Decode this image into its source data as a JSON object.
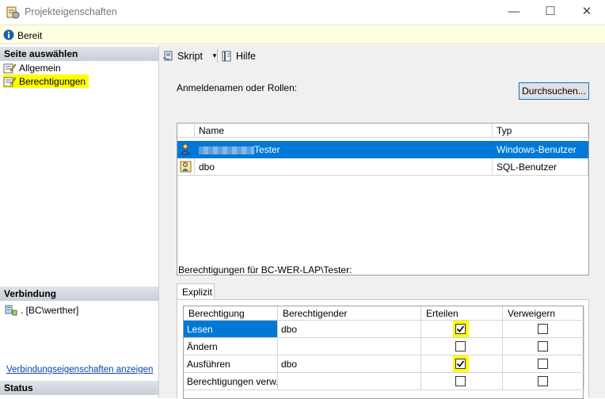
{
  "window": {
    "title": "Projekteigenschaften",
    "minimize": "—",
    "maximize": "☐",
    "close": "✕"
  },
  "status": {
    "text": "Bereit"
  },
  "left": {
    "select_page_header": "Seite auswählen",
    "pages": [
      {
        "label": "Allgemein",
        "icon": "properties-page-icon",
        "highlighted": false
      },
      {
        "label": "Berechtigungen",
        "icon": "permissions-page-icon",
        "highlighted": true
      }
    ],
    "connection_header": "Verbindung",
    "connection_value": ". [BC\\werther]",
    "connection_link": "Verbindungseigenschaften anzeigen",
    "status_header": "Status"
  },
  "toolbar": {
    "script_label": "Skript",
    "help_label": "Hilfe"
  },
  "logins": {
    "label": "Anmeldenamen oder Rollen:",
    "browse_button": "Durchsuchen...",
    "columns": [
      "Name",
      "Typ"
    ],
    "rows": [
      {
        "name": "Tester",
        "type": "Windows-Benutzer",
        "selected": true,
        "redacted_prefix": true
      },
      {
        "name": "dbo",
        "type": "SQL-Benutzer",
        "selected": false,
        "redacted_prefix": false
      }
    ]
  },
  "permissions": {
    "label": "Berechtigungen für BC-WER-LAP\\Tester:",
    "tab": "Explizit",
    "columns": [
      "Berechtigung",
      "Berechtigender",
      "Erteilen",
      "Verweigern"
    ],
    "rows": [
      {
        "permission": "Lesen",
        "grantor": "dbo",
        "grant": true,
        "deny": false,
        "selected": true
      },
      {
        "permission": "Ändern",
        "grantor": "",
        "grant": false,
        "deny": false,
        "selected": false
      },
      {
        "permission": "Ausführen",
        "grantor": "dbo",
        "grant": true,
        "deny": false,
        "selected": false
      },
      {
        "permission": "Berechtigungen verw...",
        "grantor": "",
        "grant": false,
        "deny": false,
        "selected": false
      }
    ]
  },
  "colors": {
    "selection": "#0078d7",
    "highlight": "#ffff00",
    "status_bg": "#ffffe1"
  }
}
